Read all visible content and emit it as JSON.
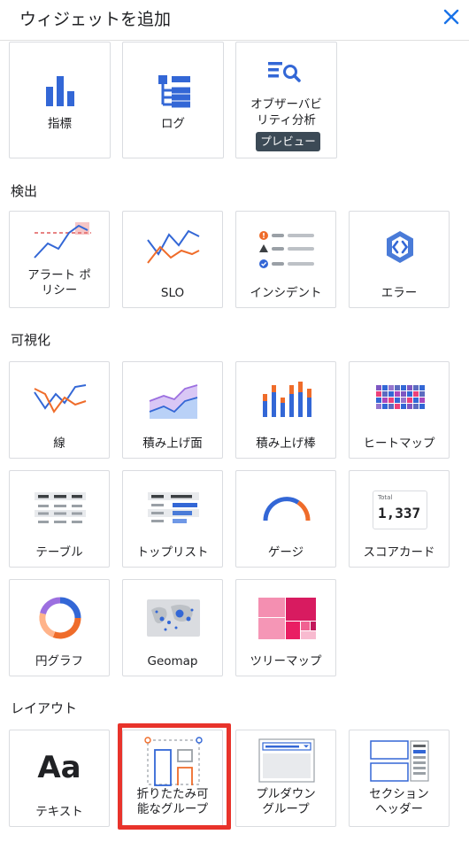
{
  "header": {
    "title": "ウィジェットを追加",
    "close_icon": "close-icon"
  },
  "sections": {
    "top": {
      "metrics": {
        "label": "指標"
      },
      "logs": {
        "label": "ログ"
      },
      "observability": {
        "label_1": "オブザーバビ",
        "label_2": "リティ分析",
        "badge": "プレビュー"
      }
    },
    "detection": {
      "title": "検出",
      "alert_policy": {
        "label_1": "アラート ポ",
        "label_2": "リシー"
      },
      "slo": {
        "label": "SLO"
      },
      "incidents": {
        "label": "インシデント"
      },
      "errors": {
        "label": "エラー"
      }
    },
    "visualization": {
      "title": "可視化",
      "line": {
        "label": "線"
      },
      "stacked_area": {
        "label": "積み上げ面"
      },
      "stacked_bar": {
        "label": "積み上げ棒"
      },
      "heatmap": {
        "label": "ヒートマップ"
      },
      "table": {
        "label": "テーブル"
      },
      "top_list": {
        "label": "トップリスト"
      },
      "gauge": {
        "label": "ゲージ"
      },
      "scorecard": {
        "label": "スコアカード",
        "total_label": "Total",
        "total_value": "1,337"
      },
      "pie": {
        "label": "円グラフ"
      },
      "geomap": {
        "label": "Geomap"
      },
      "treemap": {
        "label": "ツリーマップ"
      }
    },
    "layout": {
      "title": "レイアウト",
      "text": {
        "label": "テキスト",
        "glyph": "Aa"
      },
      "collapsible_group": {
        "label_1": "折りたたみ可",
        "label_2": "能なグループ"
      },
      "dropdown_group": {
        "label_1": "プルダウン",
        "label_2": "グループ"
      },
      "section_header": {
        "label_1": "セクション",
        "label_2": "ヘッダー"
      }
    }
  },
  "colors": {
    "primary_blue": "#3367d6",
    "orange": "#ef6c2a",
    "highlight_red": "#e8332b",
    "badge_bg": "#3c4a56"
  }
}
